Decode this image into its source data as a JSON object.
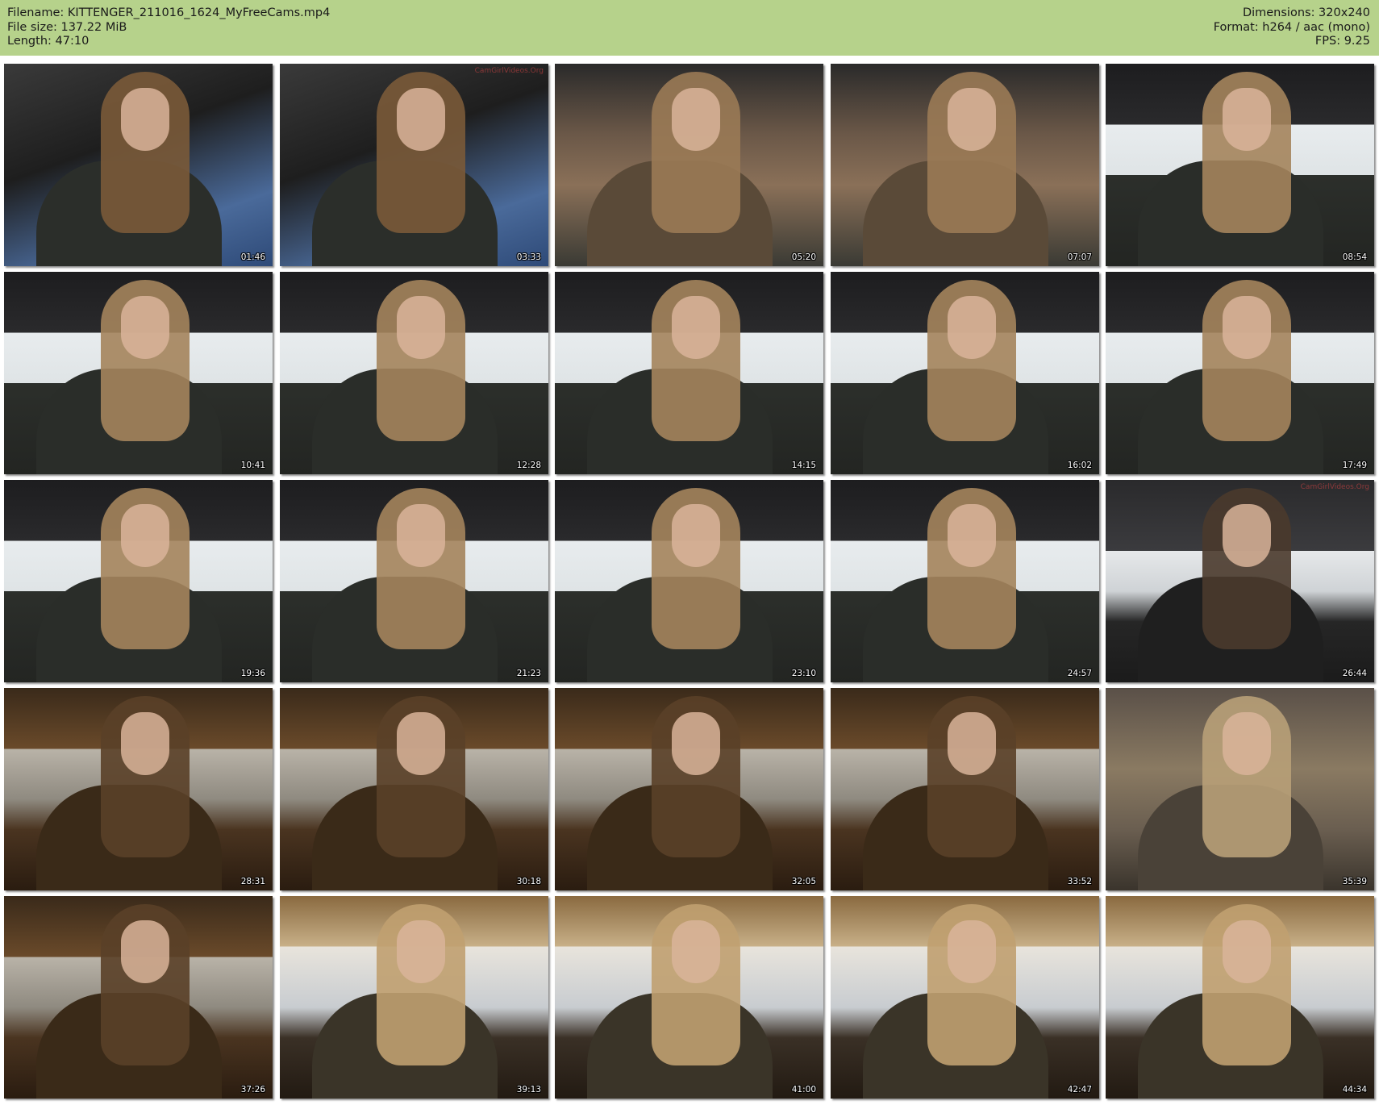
{
  "header": {
    "filename_line": "Filename: KITTENGER_211016_1624_MyFreeCams.mp4",
    "filesize_line": "File size: 137.22 MiB",
    "length_line": "Length: 47:10",
    "dimensions_line": "Dimensions: 320x240",
    "format_line": "Format: h264 / aac (mono)",
    "fps_line": "FPS: 9.25",
    "background_color": "#b6d28b"
  },
  "thumbnails": [
    {
      "timestamp": "01:46",
      "scene": "daylight-lap",
      "watermark": ""
    },
    {
      "timestamp": "03:33",
      "scene": "daylight-lap",
      "watermark": "CamGirlVideos.Org"
    },
    {
      "timestamp": "05:20",
      "scene": "daylight-closeup",
      "watermark": ""
    },
    {
      "timestamp": "07:07",
      "scene": "daylight-closeup",
      "watermark": ""
    },
    {
      "timestamp": "08:54",
      "scene": "daylight-portrait",
      "watermark": ""
    },
    {
      "timestamp": "10:41",
      "scene": "daylight-portrait",
      "watermark": ""
    },
    {
      "timestamp": "12:28",
      "scene": "daylight-portrait",
      "watermark": ""
    },
    {
      "timestamp": "14:15",
      "scene": "daylight-portrait",
      "watermark": ""
    },
    {
      "timestamp": "16:02",
      "scene": "daylight-portrait",
      "watermark": ""
    },
    {
      "timestamp": "17:49",
      "scene": "daylight-portrait",
      "watermark": ""
    },
    {
      "timestamp": "19:36",
      "scene": "daylight-portrait",
      "watermark": ""
    },
    {
      "timestamp": "21:23",
      "scene": "daylight-portrait",
      "watermark": ""
    },
    {
      "timestamp": "23:10",
      "scene": "daylight-portrait",
      "watermark": ""
    },
    {
      "timestamp": "24:57",
      "scene": "daylight-portrait",
      "watermark": ""
    },
    {
      "timestamp": "26:44",
      "scene": "dark-driving",
      "watermark": "CamGirlVideos.Org"
    },
    {
      "timestamp": "28:31",
      "scene": "warm-driving",
      "watermark": ""
    },
    {
      "timestamp": "30:18",
      "scene": "warm-driving",
      "watermark": ""
    },
    {
      "timestamp": "32:05",
      "scene": "warm-driving",
      "watermark": ""
    },
    {
      "timestamp": "33:52",
      "scene": "warm-driving",
      "watermark": ""
    },
    {
      "timestamp": "35:39",
      "scene": "blurred",
      "watermark": ""
    },
    {
      "timestamp": "37:26",
      "scene": "warm-driving",
      "watermark": ""
    },
    {
      "timestamp": "39:13",
      "scene": "sunlit-portrait",
      "watermark": ""
    },
    {
      "timestamp": "41:00",
      "scene": "sunlit-portrait",
      "watermark": ""
    },
    {
      "timestamp": "42:47",
      "scene": "sunlit-portrait",
      "watermark": ""
    },
    {
      "timestamp": "44:34",
      "scene": "sunlit-portrait",
      "watermark": ""
    }
  ]
}
